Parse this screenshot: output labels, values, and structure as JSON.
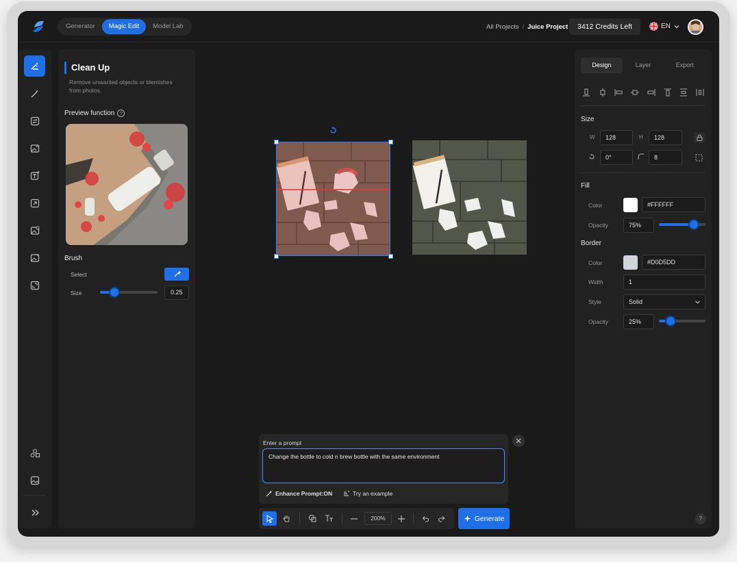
{
  "header": {
    "modes": [
      {
        "label": "Generator",
        "active": false
      },
      {
        "label": "Magic Edit",
        "active": true
      },
      {
        "label": "Model Lab",
        "active": false
      }
    ],
    "breadcrumb": {
      "root": "All Projects",
      "separator": "/",
      "current": "Juice Project"
    },
    "credits": "3412 Credits Left",
    "language": "EN"
  },
  "left_panel": {
    "title": "Clean Up",
    "description": "Remove unwanted objects or blemishes from photos.",
    "preview_label": "Preview function",
    "brush": {
      "label": "Brush",
      "select_label": "Select",
      "size_label": "Size",
      "size_value": "0.25",
      "size_fraction": 0.25
    }
  },
  "prompt": {
    "label": "Enter a prompt",
    "value": "Change the bottle to cold n brew bottle with the same environment",
    "enhance": "Enhance Prompt:ON",
    "example": "Try an example"
  },
  "toolbar": {
    "zoom": "200%",
    "generate": "Generate"
  },
  "right_panel": {
    "tabs": [
      {
        "label": "Design",
        "active": true
      },
      {
        "label": "Layer",
        "active": false
      },
      {
        "label": "Export",
        "active": false
      }
    ],
    "size": {
      "title": "Size",
      "w_label": "W",
      "w": "128",
      "h_label": "H",
      "h": "128",
      "rotation": "0°",
      "radius": "8"
    },
    "fill": {
      "title": "Fill",
      "color_label": "Color",
      "color": "#FFFFFF",
      "opacity_label": "Opacity",
      "opacity": "75%",
      "opacity_fraction": 0.75
    },
    "border": {
      "title": "Border",
      "color_label": "Color",
      "color": "#D0D5DD",
      "width_label": "Width",
      "width": "1",
      "style_label": "Style",
      "style": "Solid",
      "opacity_label": "Opacity",
      "opacity": "25%",
      "opacity_fraction": 0.25
    },
    "help": "?"
  },
  "colors": {
    "accent": "#1F6FE6",
    "background": "#1A1A1A",
    "panel": "#212121"
  }
}
